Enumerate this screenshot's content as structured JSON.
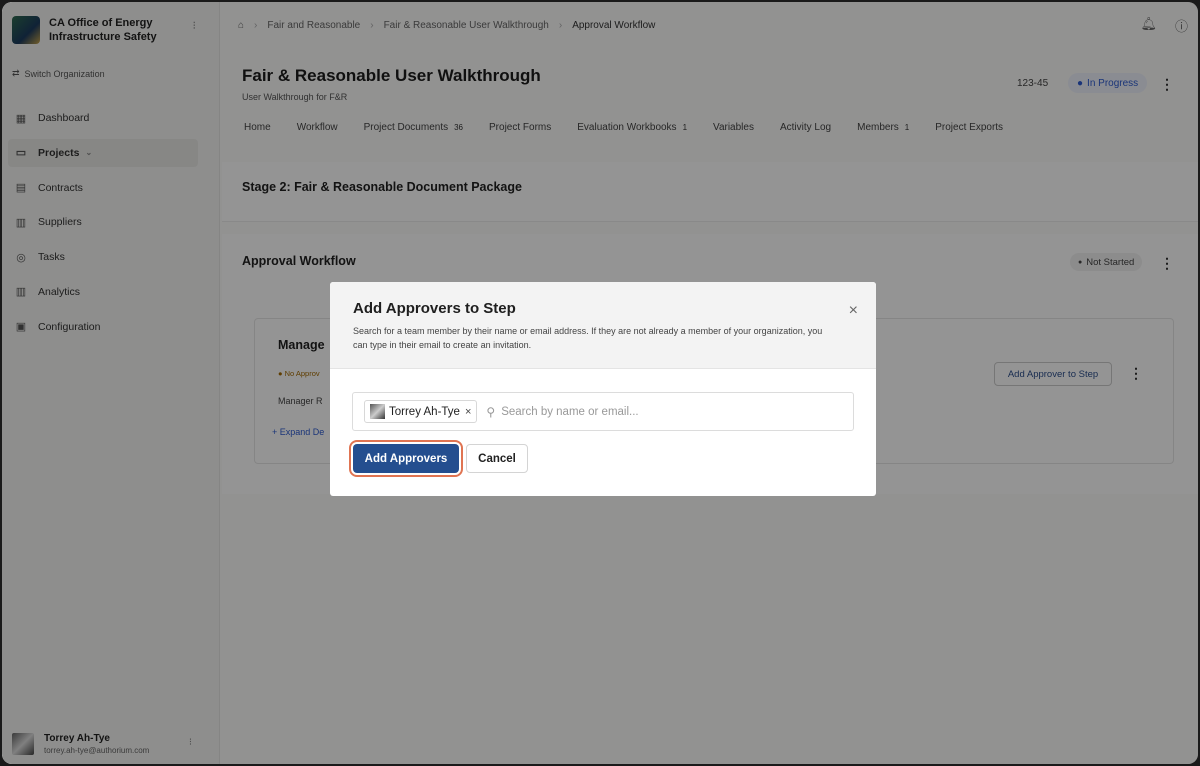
{
  "sidebar": {
    "org_name": "CA Office of Energy Infrastructure Safety",
    "switch_org": "Switch Organization",
    "items": [
      {
        "label": "Dashboard",
        "icon": "dashboard-icon"
      },
      {
        "label": "Projects",
        "icon": "projects-icon"
      },
      {
        "label": "Contracts",
        "icon": "contracts-icon"
      },
      {
        "label": "Suppliers",
        "icon": "suppliers-icon"
      },
      {
        "label": "Tasks",
        "icon": "tasks-icon"
      },
      {
        "label": "Analytics",
        "icon": "analytics-icon"
      },
      {
        "label": "Configuration",
        "icon": "configuration-icon"
      }
    ],
    "user": {
      "name": "Torrey Ah-Tye",
      "email": "torrey.ah-tye@authorium.com"
    }
  },
  "breadcrumb": [
    "Fair and Reasonable",
    "Fair & Reasonable User Walkthrough",
    "Approval Workflow"
  ],
  "header": {
    "title": "Fair & Reasonable User Walkthrough",
    "subtitle": "User Walkthrough for F&R",
    "code": "123-45",
    "status": "In Progress"
  },
  "tabs": [
    {
      "label": "Home",
      "count": ""
    },
    {
      "label": "Workflow",
      "count": ""
    },
    {
      "label": "Project Documents",
      "count": "36"
    },
    {
      "label": "Project Forms",
      "count": ""
    },
    {
      "label": "Evaluation Workbooks",
      "count": "1"
    },
    {
      "label": "Variables",
      "count": ""
    },
    {
      "label": "Activity Log",
      "count": ""
    },
    {
      "label": "Members",
      "count": "1"
    },
    {
      "label": "Project Exports",
      "count": ""
    }
  ],
  "stage": {
    "title": "Stage 2: Fair & Reasonable Document Package"
  },
  "approval": {
    "title": "Approval Workflow",
    "status": "Not Started",
    "step_title": "Manage",
    "no_approvers": "No Approv",
    "manager_text": "Manager R",
    "expand": "+ Expand De",
    "add_approver_button": "Add Approver to Step"
  },
  "modal": {
    "title": "Add Approvers to Step",
    "description": "Search for a team member by their name or email address. If they are not already a member of your organization, you can type in their email to create an invitation.",
    "chip_name": "Torrey Ah-Tye",
    "search_placeholder": "Search by name or email...",
    "add_button": "Add Approvers",
    "cancel_button": "Cancel"
  },
  "colors": {
    "primary": "#244e8f",
    "highlight_ring": "#e07452",
    "status_blue": "#2d5bd0"
  }
}
